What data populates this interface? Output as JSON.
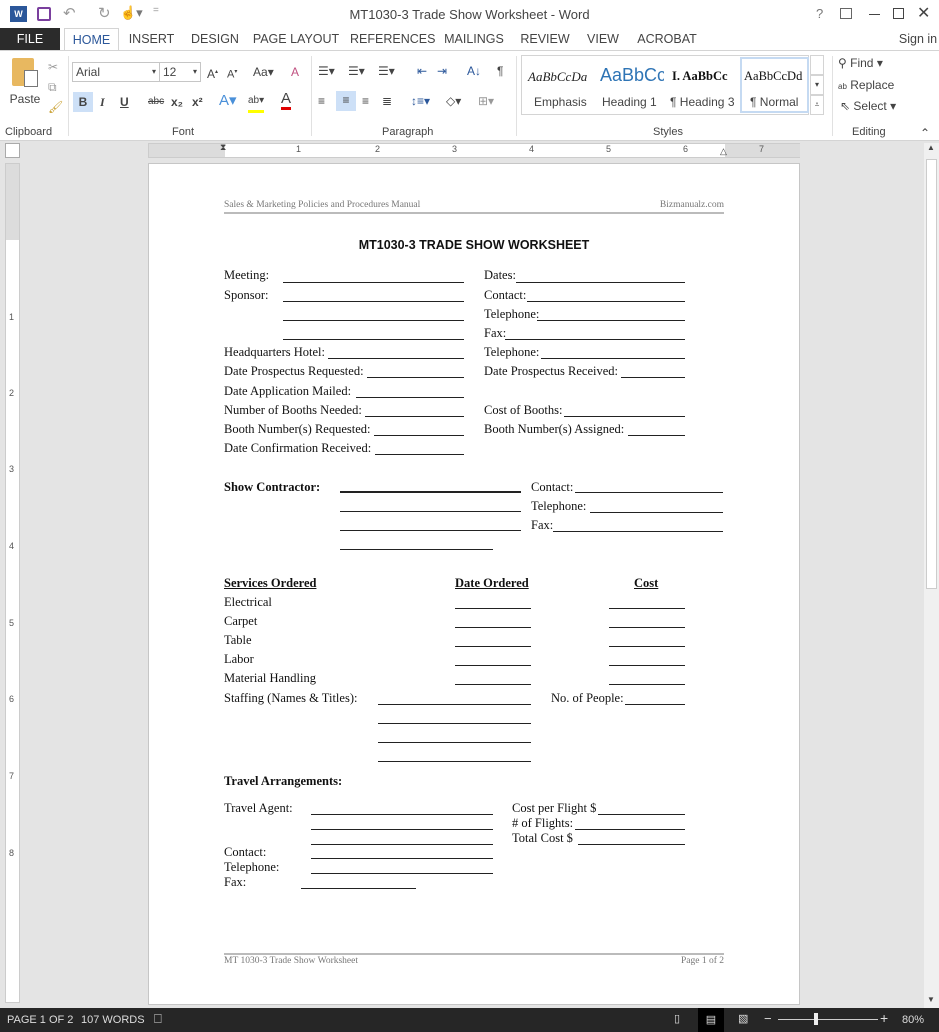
{
  "window": {
    "title": "MT1030-3 Trade Show Worksheet - Word",
    "help": "?",
    "sign_in": "Sign in"
  },
  "tabs": [
    "FILE",
    "HOME",
    "INSERT",
    "DESIGN",
    "PAGE LAYOUT",
    "REFERENCES",
    "MAILINGS",
    "REVIEW",
    "VIEW",
    "ACROBAT"
  ],
  "ribbon": {
    "clipboard": {
      "paste": "Paste",
      "label": "Clipboard"
    },
    "font": {
      "name": "Arial",
      "size": "12",
      "case": "Aa",
      "label": "Font",
      "bold": "B",
      "italic": "I",
      "underline": "U",
      "strike": "abc",
      "sub": "x₂",
      "sup": "x²",
      "highlight_color": "#ffff00",
      "font_color": "#e00000"
    },
    "paragraph": {
      "label": "Paragraph",
      "pilcrow": "¶"
    },
    "styles": {
      "label": "Styles",
      "items": [
        {
          "preview": "AaBbCcDa",
          "name": "Emphasis"
        },
        {
          "preview": "AaBbCc",
          "name": "Heading 1"
        },
        {
          "preview": "I. AaBbCc",
          "name": "¶ Heading 3"
        },
        {
          "preview": "AaBbCcDd",
          "name": "¶ Normal"
        }
      ]
    },
    "editing": {
      "label": "Editing",
      "find": "Find",
      "replace": "Replace",
      "select": "Select"
    }
  },
  "ruler": {
    "marks": [
      "1",
      "2",
      "3",
      "4",
      "5",
      "6",
      "7"
    ],
    "vmarks": [
      "1",
      "2",
      "3",
      "4",
      "5",
      "6",
      "7",
      "8"
    ]
  },
  "doc": {
    "header_left": "Sales & Marketing Policies and Procedures Manual",
    "header_right": "Bizmanualz.com",
    "title": "MT1030-3 TRADE SHOW WORKSHEET",
    "left": [
      "Meeting:",
      "Sponsor:",
      "Headquarters Hotel:",
      "Date Prospectus Requested:",
      "Date Application Mailed:",
      "Number of Booths Needed:",
      "Booth Number(s) Requested:",
      "Date Confirmation Received:"
    ],
    "right": [
      "Dates:",
      "Contact:",
      "Telephone:",
      "Fax:",
      "Telephone:",
      "Date Prospectus Received:",
      "Cost of Booths:",
      "Booth Number(s) Assigned:"
    ],
    "contractor": {
      "heading": "Show Contractor:",
      "contact": "Contact:",
      "telephone": "Telephone:",
      "fax": "Fax:"
    },
    "services": {
      "headers": [
        "Services Ordered",
        "Date Ordered",
        "Cost"
      ],
      "items": [
        "Electrical",
        "Carpet",
        "Table",
        "Labor",
        "Material Handling"
      ],
      "staffing": "Staffing (Names & Titles):",
      "people": "No. of People:"
    },
    "travel": {
      "heading": "Travel Arrangements:",
      "agent": "Travel Agent:",
      "contact": "Contact:",
      "telephone": "Telephone:",
      "fax": "Fax:",
      "cost_flight": "Cost per Flight  $",
      "flights": "# of Flights:",
      "total": "Total Cost  $"
    },
    "footer_left": "MT 1030-3 Trade Show Worksheet",
    "footer_right": "Page 1 of 2"
  },
  "status": {
    "page": "PAGE 1 OF 2",
    "words": "107 WORDS",
    "zoom": "80%",
    "zoom_percent": 80
  }
}
